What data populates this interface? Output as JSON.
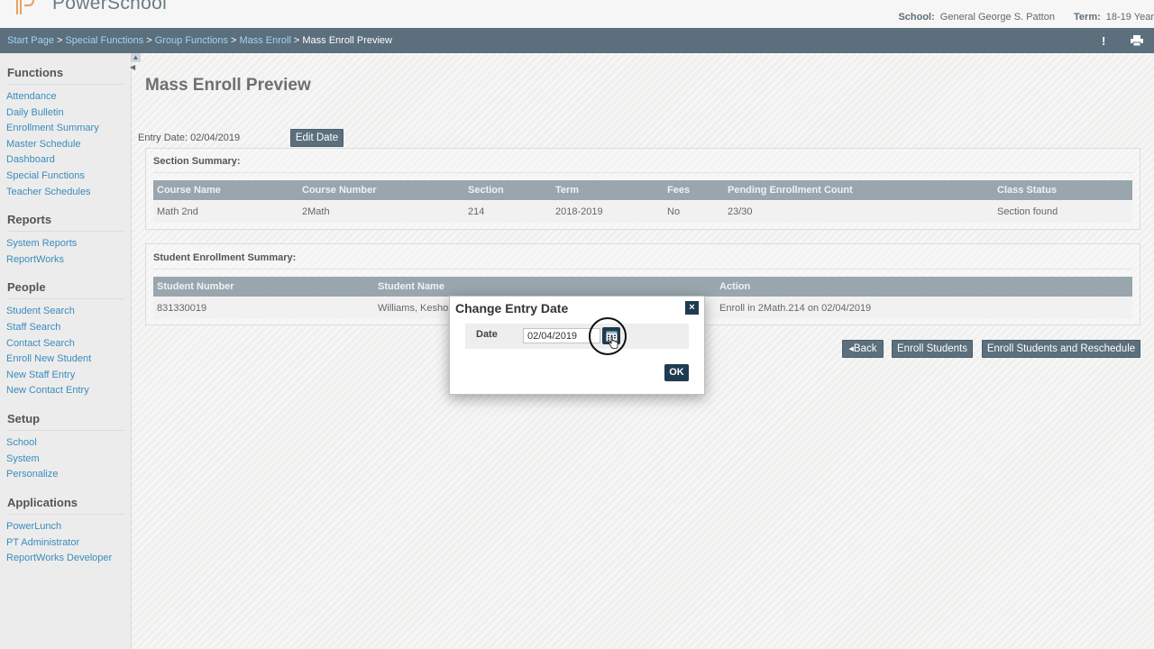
{
  "header": {
    "logo_text": "PowerSchool",
    "school_label": "School:",
    "school_value": "General George S. Patton",
    "term_label": "Term:",
    "term_value": "18-19 Year"
  },
  "breadcrumb": {
    "items": [
      "Start Page",
      "Special Functions",
      "Group Functions",
      "Mass Enroll"
    ],
    "separator": ">",
    "current": "Mass Enroll Preview",
    "alert_icon": "!",
    "print_icon": "printer-icon"
  },
  "sidebar": {
    "sections": [
      {
        "title": "Functions",
        "items": [
          "Attendance",
          "Daily Bulletin",
          "Enrollment Summary",
          "Master Schedule",
          "Dashboard",
          "Special Functions",
          "Teacher Schedules"
        ]
      },
      {
        "title": "Reports",
        "items": [
          "System Reports",
          "ReportWorks"
        ]
      },
      {
        "title": "People",
        "items": [
          "Student Search",
          "Staff Search",
          "Contact Search",
          "Enroll New Student",
          "New Staff Entry",
          "New Contact Entry"
        ]
      },
      {
        "title": "Setup",
        "items": [
          "School",
          "System",
          "Personalize"
        ]
      },
      {
        "title": "Applications",
        "items": [
          "PowerLunch",
          "PT Administrator",
          "ReportWorks Developer"
        ]
      }
    ]
  },
  "main": {
    "title": "Mass Enroll Preview",
    "entry_date_text": "Entry Date: 02/04/2019",
    "edit_date_label": "Edit Date",
    "section_summary": {
      "title": "Section Summary:",
      "columns": [
        "Course Name",
        "Course Number",
        "Section",
        "Term",
        "Fees",
        "Pending Enrollment Count",
        "Class Status"
      ],
      "rows": [
        [
          "Math 2nd",
          "2Math",
          "214",
          "2018-2019",
          "No",
          "23/30",
          "Section found"
        ]
      ]
    },
    "student_summary": {
      "title": "Student Enrollment Summary:",
      "columns": [
        "Student Number",
        "Student Name",
        "Action"
      ],
      "rows": [
        [
          "831330019",
          "Williams, Kesho",
          "Enroll in 2Math.214 on 02/04/2019"
        ]
      ]
    },
    "buttons": {
      "back": "Back",
      "enroll": "Enroll Students",
      "enroll_reschedule": "Enroll Students and Reschedule"
    }
  },
  "dialog": {
    "title": "Change Entry Date",
    "close_label": "×",
    "date_label": "Date",
    "date_value": "02/04/2019",
    "ok_label": "OK"
  },
  "colors": {
    "nav_bar": "#5b6f7d",
    "link": "#3b8bbd",
    "table_header": "#9aa6ae",
    "dialog_button": "#1f3b50"
  }
}
